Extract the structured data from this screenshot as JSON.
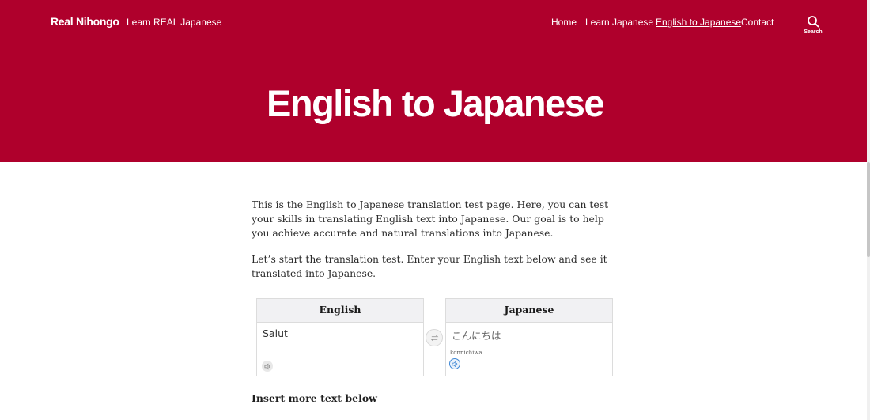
{
  "site": {
    "brand": "Real Nihongo",
    "tagline": "Learn REAL Japanese"
  },
  "nav": {
    "items": [
      {
        "label": "Home"
      },
      {
        "label": "Learn Japanese"
      },
      {
        "label": "English to Japanese",
        "active": true
      },
      {
        "label": "Contact"
      }
    ],
    "search_label": "Search"
  },
  "page": {
    "title": "English to Japanese",
    "intro": "This is the English to Japanese translation test page. Here, you can test your skills in translating English text into Japanese. Our goal is to help you achieve accurate and natural translations into Japanese.",
    "instructions": "Let’s start the translation test. Enter your English text below and see it translated into Japanese.",
    "insert_more": "Insert more text below"
  },
  "translator": {
    "source": {
      "label": "English",
      "text": "Salut"
    },
    "target": {
      "label": "Japanese",
      "text": "こんにちは",
      "romaji": "konnichiwa"
    }
  },
  "colors": {
    "brand_red": "#af002c",
    "header_text": "#ffffff",
    "box_header_bg": "#f1f1f3",
    "speaker_active": "#3f88d6"
  },
  "icons": {
    "search": "search-icon",
    "speaker": "speaker-icon",
    "swap": "swap-icon"
  }
}
